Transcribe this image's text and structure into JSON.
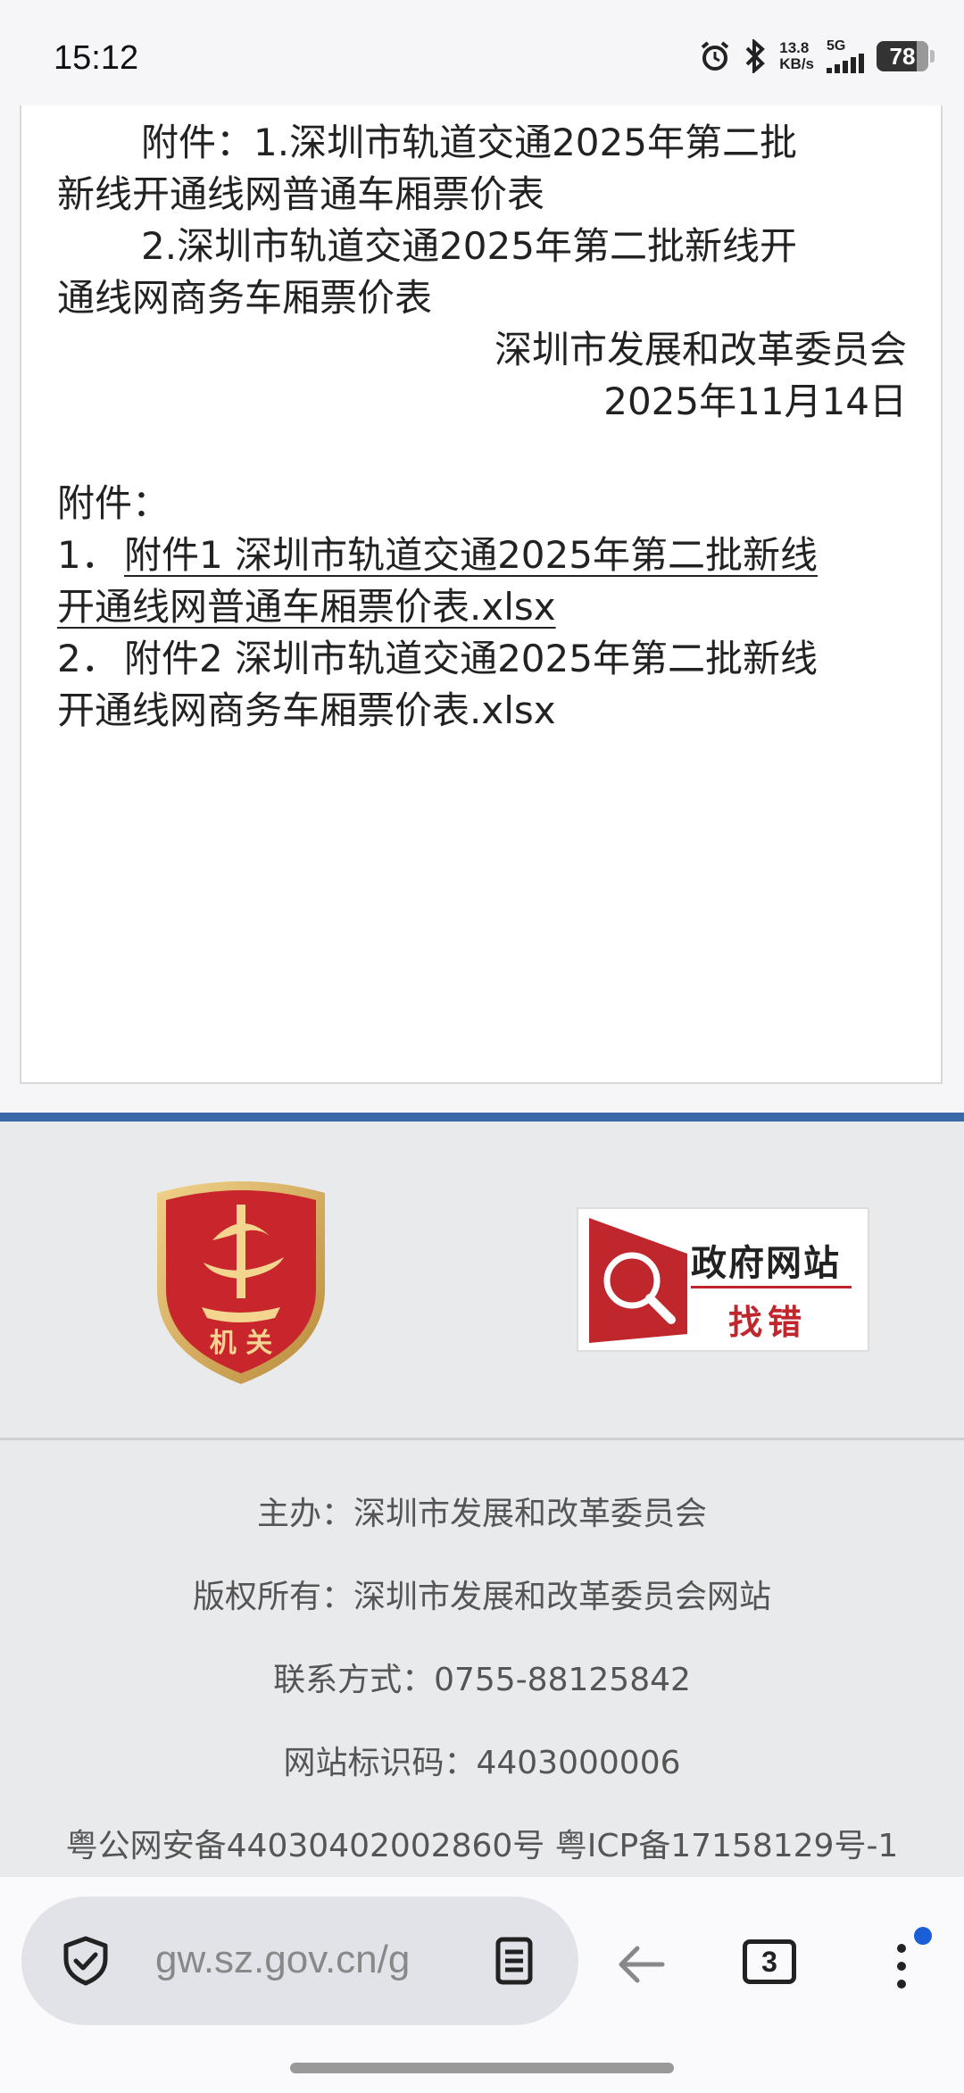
{
  "status_bar": {
    "time": "15:12",
    "net_speed_value": "13.8",
    "net_speed_unit": "KB/s",
    "network": "5G",
    "battery": "78",
    "icons": [
      "alarm-icon",
      "bluetooth-icon",
      "signal-icon",
      "battery-icon"
    ]
  },
  "article": {
    "lines": [
      "附件：1.深圳市轨道交通2025年第二批",
      "新线开通线网普通车厢票价表",
      "2.深圳市轨道交通2025年第二批新线开",
      "通线网商务车厢票价表"
    ],
    "signature": "深圳市发展和改革委员会",
    "date": "2025年11月14日",
    "attachments_heading": "附件：",
    "attachments": [
      {
        "number": "1．",
        "line1": "附件1 深圳市轨道交通2025年第二批新线",
        "line2": "开通线网普通车厢票价表.xlsx"
      },
      {
        "number": "2．",
        "line1": "附件2 深圳市轨道交通2025年第二批新线",
        "line2": "开通线网商务车厢票价表.xlsx"
      }
    ]
  },
  "footer": {
    "badge_text": "机 关",
    "report_title": "政府网站",
    "report_sub": "找错",
    "lines": [
      "主办：深圳市发展和改革委员会",
      "版权所有：深圳市发展和改革委员会网站",
      "联系方式：0755-88125842",
      "网站标识码：4403000006",
      "粤公网安备44030402002860号 粤ICP备17158129号-1"
    ],
    "accent_color": "#3a6aa8"
  },
  "browser": {
    "url": "gw.sz.gov.cn/g",
    "tab_count": "3",
    "icons": [
      "shield-icon",
      "reader-mode-icon",
      "back-arrow-icon",
      "tabs-icon",
      "more-menu-icon"
    ]
  }
}
